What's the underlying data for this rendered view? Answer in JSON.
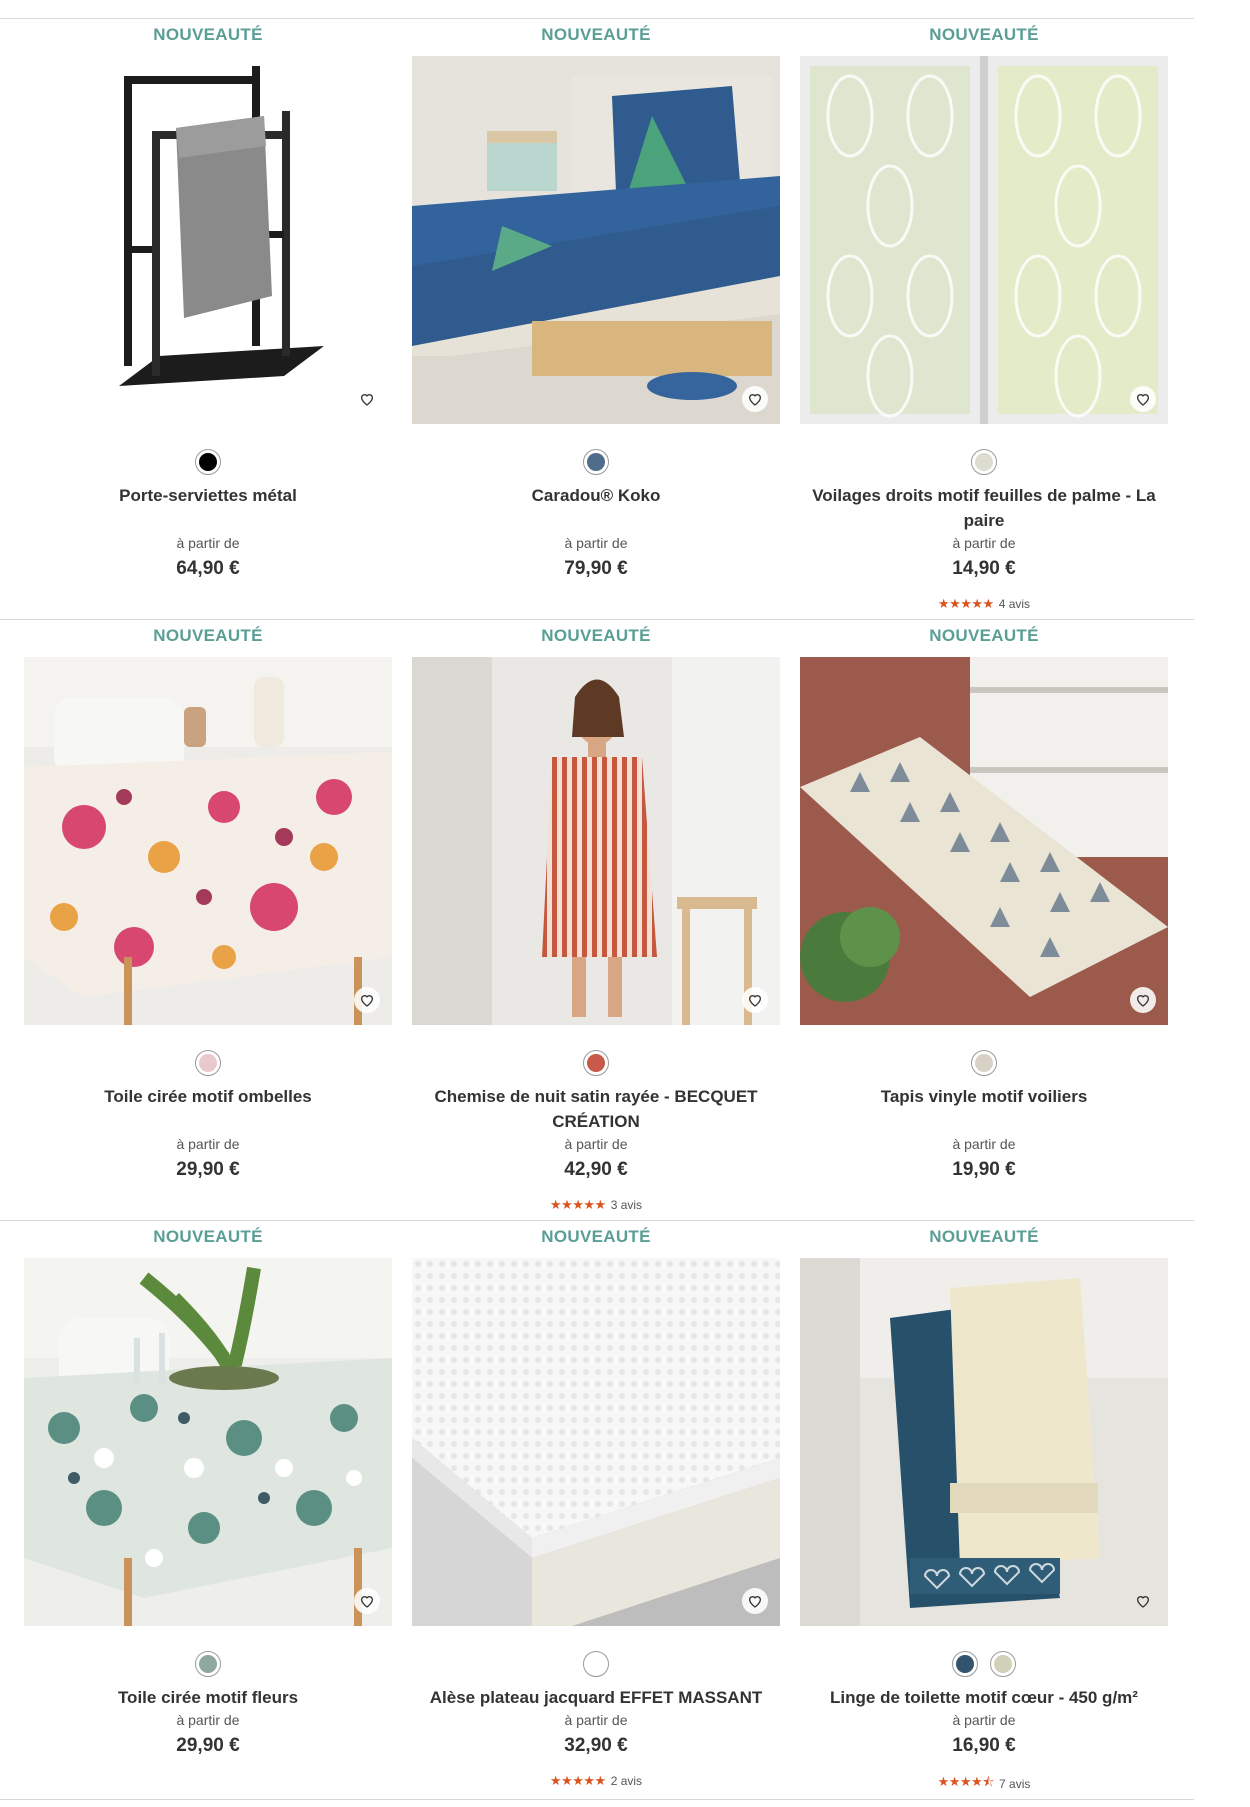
{
  "products": [
    {
      "badge": "NOUVEAUTÉ",
      "name": "Porte-serviettes métal",
      "from": "à partir de",
      "price": "64,90 €",
      "swatches": [
        "#000000"
      ],
      "favorite_icon": "heart-icon"
    },
    {
      "badge": "NOUVEAUTÉ",
      "name": "Caradou® Koko",
      "from": "à partir de",
      "price": "79,90 €",
      "swatches": [
        "#4f6c8a"
      ],
      "favorite_icon": "heart-icon"
    },
    {
      "badge": "NOUVEAUTÉ",
      "name": "Voilages droits motif feuilles de palme - La paire",
      "from": "à partir de",
      "price": "14,90 €",
      "swatches": [
        "#dcdcd0"
      ],
      "rating": "★★★★★",
      "reviews": "4 avis",
      "favorite_icon": "heart-icon"
    },
    {
      "badge": "NOUVEAUTÉ",
      "name": "Toile cirée motif ombelles",
      "from": "à partir de",
      "price": "29,90 €",
      "swatches": [
        "#e9c9cc"
      ],
      "favorite_icon": "heart-icon"
    },
    {
      "badge": "NOUVEAUTÉ",
      "name": "Chemise de nuit satin rayée - BECQUET CRÉATION",
      "from": "à partir de",
      "price": "42,90 €",
      "swatches": [
        "#c85a4a"
      ],
      "rating": "★★★★★",
      "reviews": "3 avis",
      "favorite_icon": "heart-icon"
    },
    {
      "badge": "NOUVEAUTÉ",
      "name": "Tapis vinyle motif voiliers",
      "from": "à partir de",
      "price": "19,90 €",
      "swatches": [
        "#d8d2c6"
      ],
      "favorite_icon": "heart-icon"
    },
    {
      "badge": "NOUVEAUTÉ",
      "name": "Toile cirée motif fleurs",
      "from": "à partir de",
      "price": "29,90 €",
      "swatches": [
        "#8fa9a0"
      ],
      "favorite_icon": "heart-icon"
    },
    {
      "badge": "NOUVEAUTÉ",
      "name": "Alèse plateau jacquard EFFET MASSANT",
      "from": "à partir de",
      "price": "32,90 €",
      "swatches": [
        "#ffffff"
      ],
      "rating": "★★★★★",
      "reviews": "2 avis",
      "favorite_icon": "heart-icon"
    },
    {
      "badge": "NOUVEAUTÉ",
      "name": "Linge de toilette motif cœur - 450 g/m²",
      "from": "à partir de",
      "price": "16,90 €",
      "swatches": [
        "#33536f",
        "#cfd1b9"
      ],
      "rating": "★★★★⯪",
      "reviews": "7 avis",
      "favorite_icon": "heart-icon"
    }
  ],
  "colors": {
    "badge": "#5a9e95",
    "stars": "#d9541e",
    "divider": "#d8d8d8"
  }
}
